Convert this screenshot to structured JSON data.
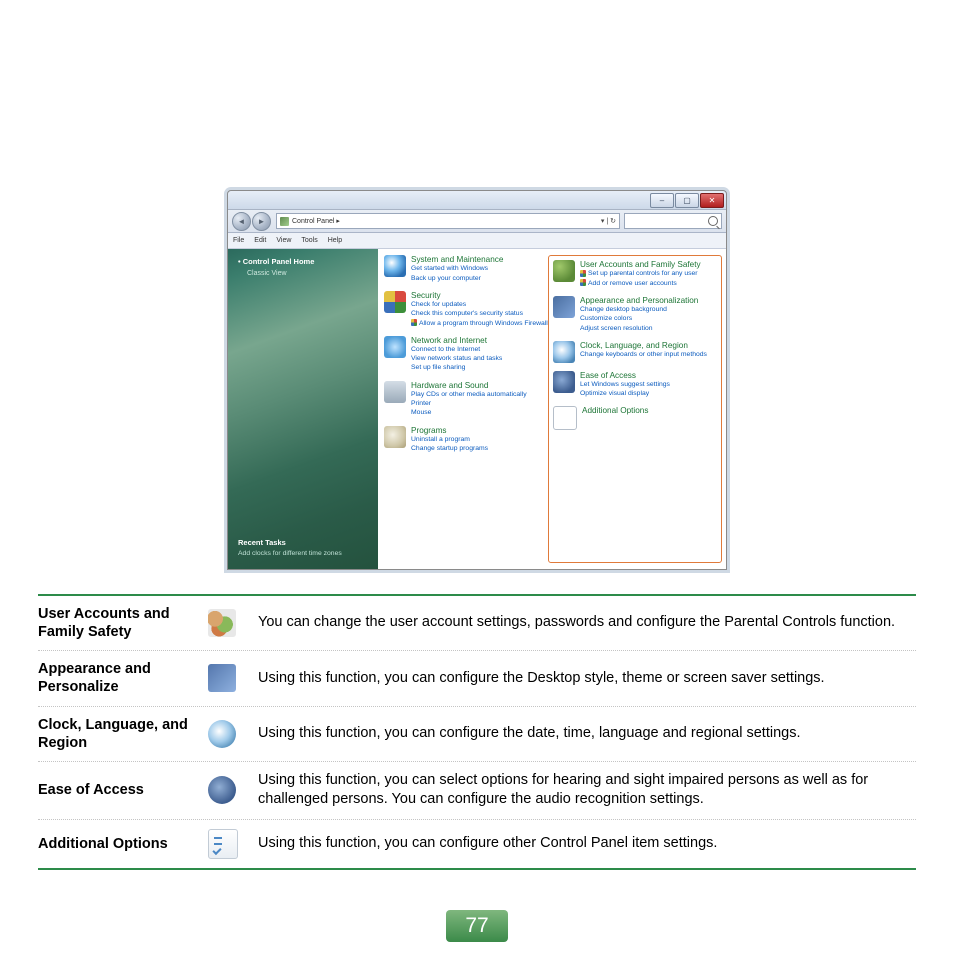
{
  "page_number": "77",
  "window": {
    "breadcrumb": "Control Panel  ▸",
    "menus": [
      "File",
      "Edit",
      "View",
      "Tools",
      "Help"
    ],
    "sidebar": {
      "home": "Control Panel Home",
      "classic": "Classic View",
      "recent_heading": "Recent Tasks",
      "recent_link": "Add clocks for different time zones"
    },
    "left_col": [
      {
        "icon": "ic-globe-blue",
        "title": "System and Maintenance",
        "subs": [
          "Get started with Windows",
          "Back up your computer"
        ]
      },
      {
        "icon": "ic-shield",
        "title": "Security",
        "subs": [
          "Check for updates",
          "Check this computer's security status"
        ],
        "shielded": [
          "Allow a program through Windows Firewall"
        ]
      },
      {
        "icon": "ic-net",
        "title": "Network and Internet",
        "subs": [
          "Connect to the Internet",
          "View network status and tasks",
          "Set up file sharing"
        ]
      },
      {
        "icon": "ic-hw",
        "title": "Hardware and Sound",
        "subs": [
          "Play CDs or other media automatically",
          "Printer",
          "Mouse"
        ]
      },
      {
        "icon": "ic-prog",
        "title": "Programs",
        "subs": [
          "Uninstall a program",
          "Change startup programs"
        ]
      }
    ],
    "right_col": [
      {
        "icon": "ic-users",
        "title": "User Accounts and Family Safety",
        "shielded": [
          "Set up parental controls for any user",
          "Add or remove user accounts"
        ]
      },
      {
        "icon": "ic-appear",
        "title": "Appearance and Personalization",
        "subs": [
          "Change desktop background",
          "Customize colors",
          "Adjust screen resolution"
        ]
      },
      {
        "icon": "ic-clock",
        "title": "Clock, Language, and Region",
        "subs": [
          "Change keyboards or other input methods"
        ]
      },
      {
        "icon": "ic-ease",
        "title": "Ease of Access",
        "subs": [
          "Let Windows suggest settings",
          "Optimize visual display"
        ]
      },
      {
        "icon": "ic-add",
        "title": "Additional Options",
        "subs": []
      }
    ]
  },
  "doc_rows": [
    {
      "label": "User Accounts and Family Safety",
      "icon": "users",
      "desc": "You can change the user account settings, passwords and configure the Parental Controls function."
    },
    {
      "label": "Appearance and Personalize",
      "icon": "appear",
      "desc": "Using this function, you can configure the Desktop style, theme or screen saver settings."
    },
    {
      "label": "Clock, Language, and Region",
      "icon": "clock",
      "desc": "Using this function, you can configure the date, time, language and regional settings."
    },
    {
      "label": "Ease of Access",
      "icon": "ease",
      "desc": "Using this function, you can select options for hearing and sight impaired persons as well as for challenged persons. You can configure the audio recognition settings."
    },
    {
      "label": "Additional Options",
      "icon": "add",
      "desc": "Using this function, you can configure other Control Panel item settings."
    }
  ]
}
